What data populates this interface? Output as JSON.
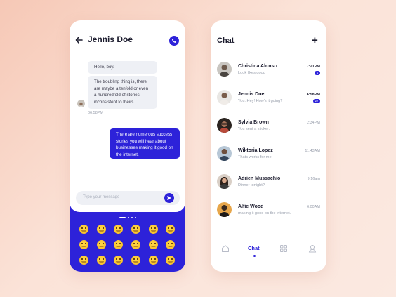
{
  "chat_screen": {
    "contact_name": "Jennis Doe",
    "messages_received": [
      "Hello, boy.",
      "The troubling thing is, there are maybe a tenfold or even a hundredfold of stories inconsistent to theirs."
    ],
    "received_time": "06:58PM",
    "message_sent": "There are numerous success stories you will hear about businesses making it good on the internet.",
    "input_placeholder": "Type your message"
  },
  "list_screen": {
    "title": "Chat",
    "conversations": [
      {
        "name": "Christina Alonso",
        "message": "Look likes good",
        "time": "7:21PM",
        "unread": "1"
      },
      {
        "name": "Jennis Doe",
        "message": "You: Hey! How's it going?",
        "time": "6:58PM",
        "unread": "27"
      },
      {
        "name": "Sylvia Brown",
        "message": "You sent a sticker.",
        "time": "2:34PM",
        "unread": ""
      },
      {
        "name": "Wiktoria Lopez",
        "message": "Thats works for me",
        "time": "11:43AM",
        "unread": ""
      },
      {
        "name": "Adrien Mussachio",
        "message": "Dinner tonight?",
        "time": "9:16am",
        "unread": ""
      },
      {
        "name": "Alfie Wood",
        "message": "making it good on the internet.",
        "time": "6:00AM",
        "unread": ""
      }
    ],
    "nav_label": "Chat"
  },
  "accent_color": "#2d22d9"
}
